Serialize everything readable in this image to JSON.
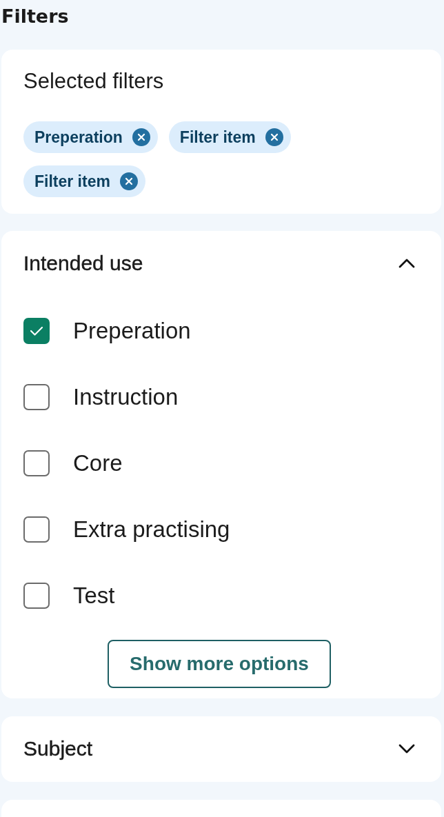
{
  "title": "Filters",
  "selected_filters": {
    "title": "Selected filters",
    "chips": [
      {
        "label": "Preperation"
      },
      {
        "label": "Filter item"
      },
      {
        "label": "Filter item"
      }
    ]
  },
  "sections": [
    {
      "title": "Intended use",
      "expanded": true,
      "options": [
        {
          "label": "Preperation",
          "checked": true
        },
        {
          "label": "Instruction",
          "checked": false
        },
        {
          "label": "Core",
          "checked": false
        },
        {
          "label": "Extra practising",
          "checked": false
        },
        {
          "label": "Test",
          "checked": false
        }
      ],
      "button": "Show more options"
    },
    {
      "title": "Subject",
      "expanded": false
    }
  ]
}
